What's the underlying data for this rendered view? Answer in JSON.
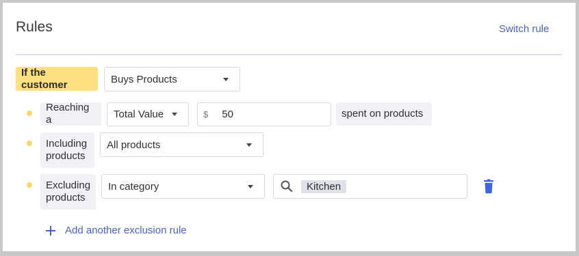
{
  "header": {
    "title": "Rules",
    "switch_label": "Switch rule"
  },
  "condition": {
    "label": "If the customer",
    "select_value": "Buys Products"
  },
  "rules": [
    {
      "label": "Reaching a",
      "select_value": "Total Value",
      "currency_symbol": "$",
      "amount": "50",
      "suffix": "spent on products"
    },
    {
      "label": "Including products",
      "select_value": "All products"
    },
    {
      "label": "Excluding products",
      "select_value": "In category",
      "chip": "Kitchen"
    }
  ],
  "add_exclusion_label": "Add another exclusion rule",
  "icons": {
    "caret": "chevron-down-icon",
    "search": "search-icon",
    "trash": "trash-icon",
    "plus": "plus-icon"
  },
  "colors": {
    "accent": "#4a63c9",
    "highlight": "#ffe07f",
    "bullet": "#f8d86a",
    "delete": "#3e64e0"
  }
}
